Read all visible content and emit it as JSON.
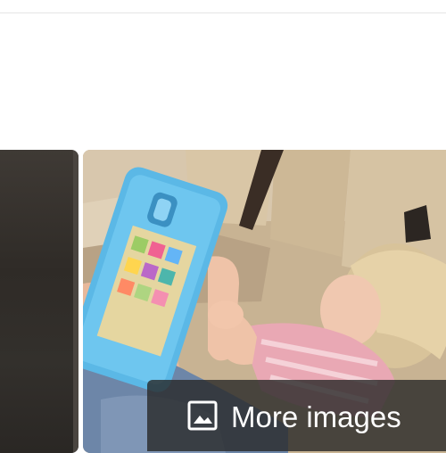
{
  "more_images": {
    "label": "More images",
    "icon": "image-icon"
  },
  "thumbnails": [
    {
      "id": "left-thumbnail",
      "description_visible": false
    },
    {
      "id": "main-thumbnail",
      "description_visible": false
    }
  ],
  "colors": {
    "overlay": "#282828",
    "divider": "#e5e5e5",
    "tablet_case": "#5bb8e6"
  }
}
